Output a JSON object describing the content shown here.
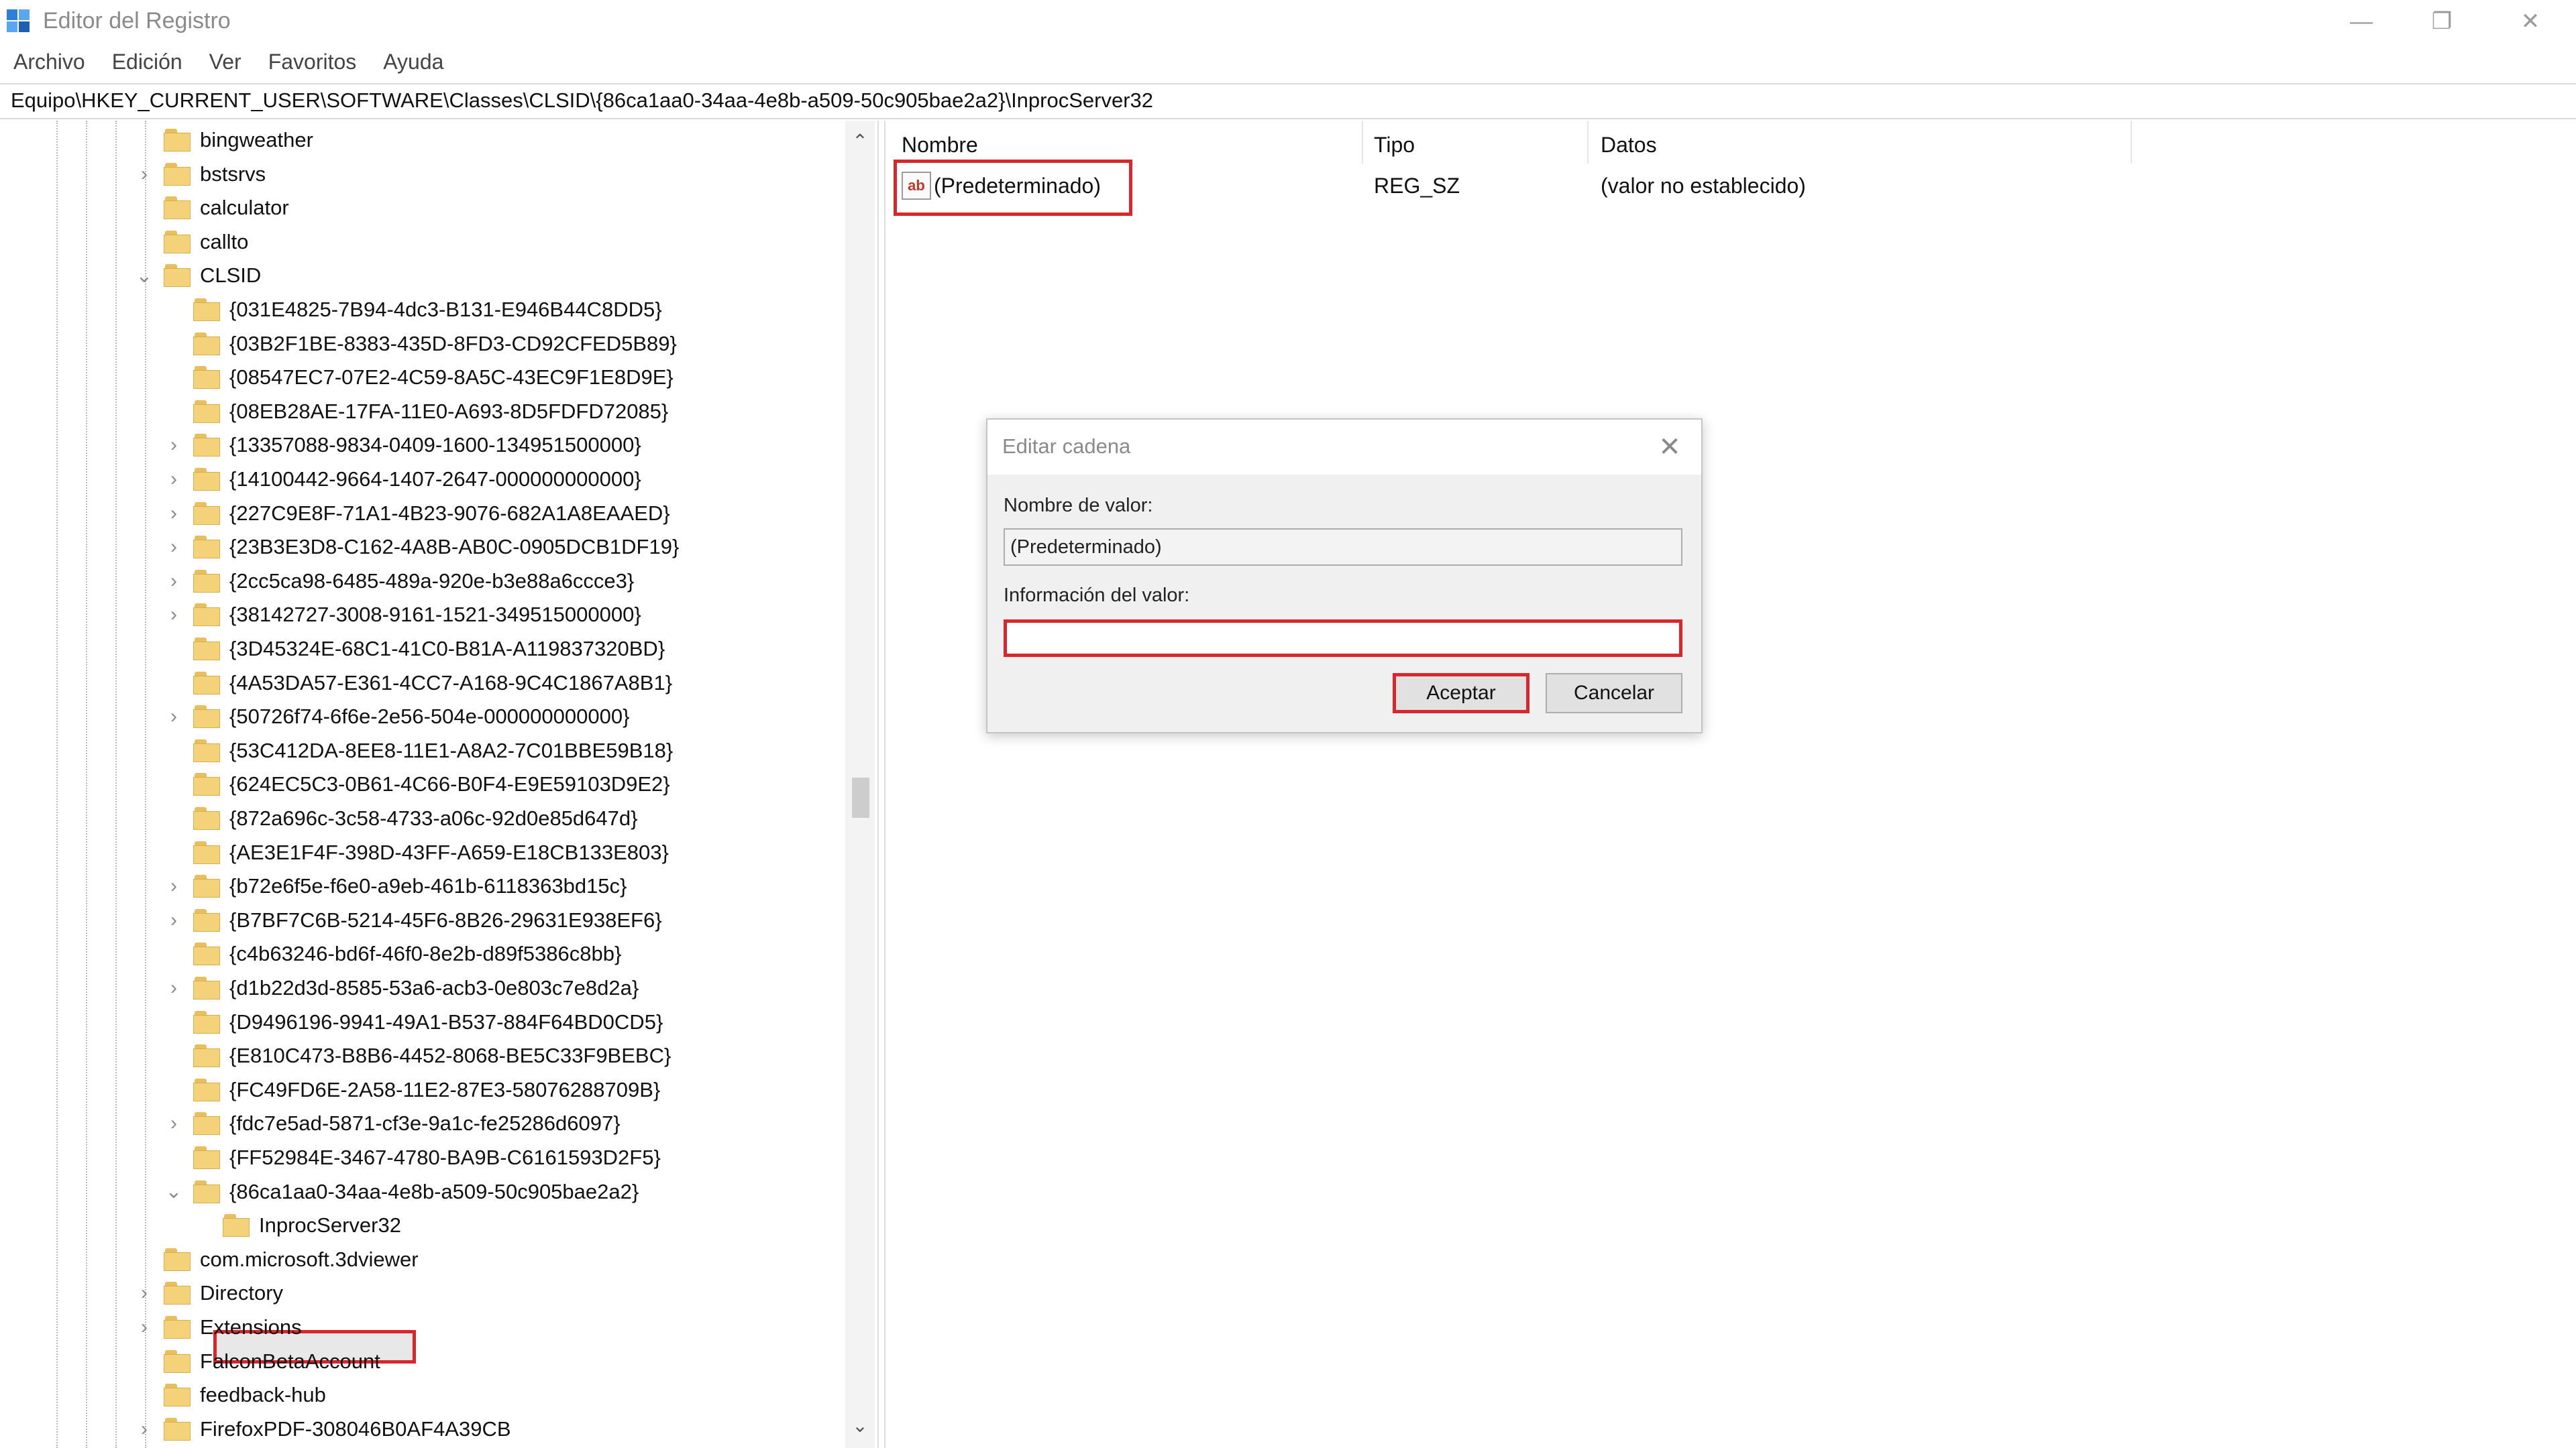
{
  "window": {
    "title": "Editor del Registro",
    "controls": {
      "minimize": "—",
      "maximize": "❐",
      "close": "✕"
    }
  },
  "menu": [
    "Archivo",
    "Edición",
    "Ver",
    "Favoritos",
    "Ayuda"
  ],
  "address": "Equipo\\HKEY_CURRENT_USER\\SOFTWARE\\Classes\\CLSID\\{86ca1aa0-34aa-4e8b-a509-50c905bae2a2}\\InprocServer32",
  "tree": {
    "scroll_up": "⌃",
    "scroll_down": "⌄",
    "items": [
      "bingweather",
      "bstsrvs",
      "calculator",
      "callto",
      "CLSID",
      "{031E4825-7B94-4dc3-B131-E946B44C8DD5}",
      "{03B2F1BE-8383-435D-8FD3-CD92CFED5B89}",
      "{08547EC7-07E2-4C59-8A5C-43EC9F1E8D9E}",
      "{08EB28AE-17FA-11E0-A693-8D5FDFD72085}",
      "{13357088-9834-0409-1600-134951500000}",
      "{14100442-9664-1407-2647-000000000000}",
      "{227C9E8F-71A1-4B23-9076-682A1A8EAAED}",
      "{23B3E3D8-C162-4A8B-AB0C-0905DCB1DF19}",
      "{2cc5ca98-6485-489a-920e-b3e88a6ccce3}",
      "{38142727-3008-9161-1521-349515000000}",
      "{3D45324E-68C1-41C0-B81A-A119837320BD}",
      "{4A53DA57-E361-4CC7-A168-9C4C1867A8B1}",
      "{50726f74-6f6e-2e56-504e-000000000000}",
      "{53C412DA-8EE8-11E1-A8A2-7C01BBE59B18}",
      "{624EC5C3-0B61-4C66-B0F4-E9E59103D9E2}",
      "{872a696c-3c58-4733-a06c-92d0e85d647d}",
      "{AE3E1F4F-398D-43FF-A659-E18CB133E803}",
      "{b72e6f5e-f6e0-a9eb-461b-6118363bd15c}",
      "{B7BF7C6B-5214-45F6-8B26-29631E938EF6}",
      "{c4b63246-bd6f-46f0-8e2b-d89f5386c8bb}",
      "{d1b22d3d-8585-53a6-acb3-0e803c7e8d2a}",
      "{D9496196-9941-49A1-B537-884F64BD0CD5}",
      "{E810C473-B8B6-4452-8068-BE5C33F9BEBC}",
      "{FC49FD6E-2A58-11E2-87E3-58076288709B}",
      "{fdc7e5ad-5871-cf3e-9a1c-fe25286d6097}",
      "{FF52984E-3467-4780-BA9B-C6161593D2F5}",
      "{86ca1aa0-34aa-4e8b-a509-50c905bae2a2}",
      "InprocServer32",
      "com.microsoft.3dviewer",
      "Directory",
      "Extensions",
      "FalconBetaAccount",
      "feedback-hub",
      "FirefoxPDF-308046B0AF4A39CB"
    ],
    "expander_collapsed": "›",
    "expander_expanded": "⌄"
  },
  "values": {
    "columns": [
      "Nombre",
      "Tipo",
      "Datos"
    ],
    "rows": [
      {
        "icon": "ab",
        "name": "(Predeterminado)",
        "type": "REG_SZ",
        "data": "(valor no establecido)"
      }
    ]
  },
  "dialog": {
    "title": "Editar cadena",
    "close": "✕",
    "name_label": "Nombre de valor:",
    "name_value": "(Predeterminado)",
    "data_label": "Información del valor:",
    "data_value": "",
    "ok_label": "Aceptar",
    "cancel_label": "Cancelar"
  },
  "colors": {
    "highlight": "#d9262c",
    "folder": "#f4d27a",
    "dialog_bg": "#f0f0f0"
  }
}
